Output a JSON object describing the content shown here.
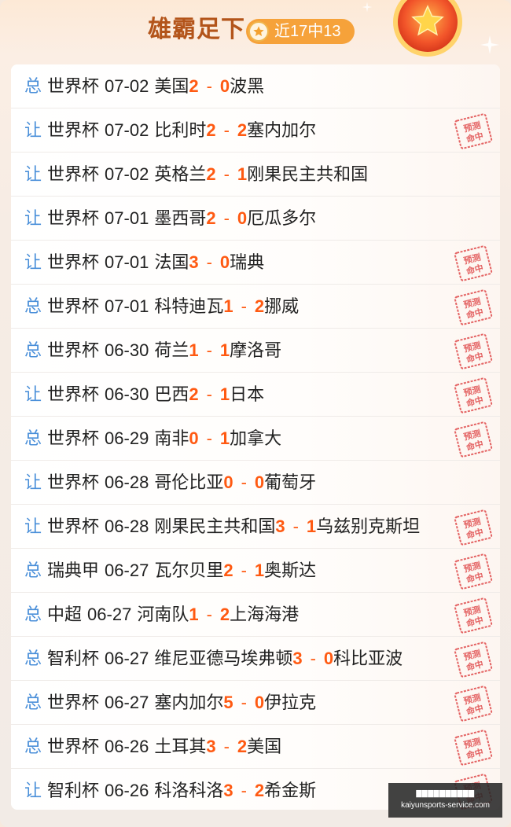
{
  "header": {
    "title": "雄霸足下",
    "record": "近17中13",
    "medal_icon": "medal-star-icon",
    "colors": {
      "title": "#b3541a",
      "badge": "#f6a23a",
      "score": "#ff5a12",
      "bet_type": "#4a8fd9",
      "stamp": "#e05555"
    }
  },
  "stamp_text": [
    "预测",
    "命中"
  ],
  "matches": [
    {
      "bet_type": "总",
      "league": "世界杯",
      "date": "07-02",
      "home": "美国",
      "home_score": "2",
      "away_score": "0",
      "away": "波黑",
      "hit": false
    },
    {
      "bet_type": "让",
      "league": "世界杯",
      "date": "07-02",
      "home": "比利时",
      "home_score": "2",
      "away_score": "2",
      "away": "塞内加尔",
      "hit": true
    },
    {
      "bet_type": "让",
      "league": "世界杯",
      "date": "07-02",
      "home": "英格兰",
      "home_score": "2",
      "away_score": "1",
      "away": "刚果民主共和国",
      "hit": false
    },
    {
      "bet_type": "让",
      "league": "世界杯",
      "date": "07-01",
      "home": "墨西哥",
      "home_score": "2",
      "away_score": "0",
      "away": "厄瓜多尔",
      "hit": false
    },
    {
      "bet_type": "让",
      "league": "世界杯",
      "date": "07-01",
      "home": "法国",
      "home_score": "3",
      "away_score": "0",
      "away": "瑞典",
      "hit": true
    },
    {
      "bet_type": "总",
      "league": "世界杯",
      "date": "07-01",
      "home": "科特迪瓦",
      "home_score": "1",
      "away_score": "2",
      "away": "挪威",
      "hit": true
    },
    {
      "bet_type": "总",
      "league": "世界杯",
      "date": "06-30",
      "home": "荷兰",
      "home_score": "1",
      "away_score": "1",
      "away": "摩洛哥",
      "hit": true
    },
    {
      "bet_type": "让",
      "league": "世界杯",
      "date": "06-30",
      "home": "巴西",
      "home_score": "2",
      "away_score": "1",
      "away": "日本",
      "hit": true
    },
    {
      "bet_type": "总",
      "league": "世界杯",
      "date": "06-29",
      "home": "南非",
      "home_score": "0",
      "away_score": "1",
      "away": "加拿大",
      "hit": true
    },
    {
      "bet_type": "让",
      "league": "世界杯",
      "date": "06-28",
      "home": "哥伦比亚",
      "home_score": "0",
      "away_score": "0",
      "away": "葡萄牙",
      "hit": false
    },
    {
      "bet_type": "让",
      "league": "世界杯",
      "date": "06-28",
      "home": "刚果民主共和国",
      "home_score": "3",
      "away_score": "1",
      "away": "乌兹别克斯坦",
      "hit": true
    },
    {
      "bet_type": "总",
      "league": "瑞典甲",
      "date": "06-27",
      "home": "瓦尔贝里",
      "home_score": "2",
      "away_score": "1",
      "away": "奥斯达",
      "hit": true
    },
    {
      "bet_type": "总",
      "league": "中超",
      "date": "06-27",
      "home": "河南队",
      "home_score": "1",
      "away_score": "2",
      "away": "上海海港",
      "hit": true
    },
    {
      "bet_type": "总",
      "league": "智利杯",
      "date": "06-27",
      "home": "维尼亚德马埃弗顿",
      "home_score": "3",
      "away_score": "0",
      "away": "科比亚波",
      "hit": true
    },
    {
      "bet_type": "总",
      "league": "世界杯",
      "date": "06-27",
      "home": "塞内加尔",
      "home_score": "5",
      "away_score": "0",
      "away": "伊拉克",
      "hit": true
    },
    {
      "bet_type": "总",
      "league": "世界杯",
      "date": "06-26",
      "home": "土耳其",
      "home_score": "3",
      "away_score": "2",
      "away": "美国",
      "hit": true
    },
    {
      "bet_type": "让",
      "league": "智利杯",
      "date": "06-26",
      "home": "科洛科洛",
      "home_score": "3",
      "away_score": "2",
      "away": "希金斯",
      "hit": true
    }
  ],
  "watermark": {
    "line1": "▇▇▇▇▇▇▇▇▇▇",
    "line2": "kaiyunsports-service.com"
  }
}
